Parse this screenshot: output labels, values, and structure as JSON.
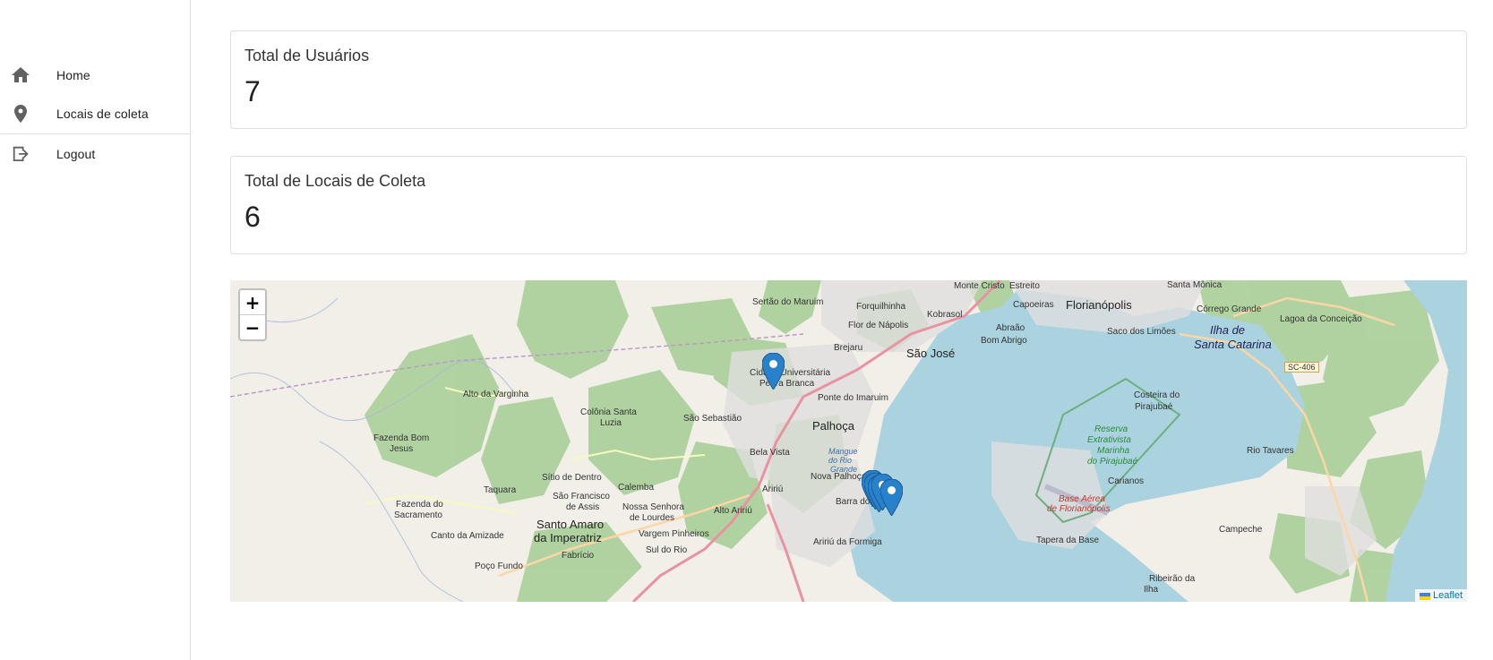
{
  "sidebar": {
    "items": [
      {
        "label": "Home",
        "icon": "home-icon"
      },
      {
        "label": "Locais de coleta",
        "icon": "location-pin-icon"
      },
      {
        "label": "Logout",
        "icon": "logout-icon"
      }
    ]
  },
  "stats": {
    "users": {
      "title": "Total de Usuários",
      "value": "7"
    },
    "locations": {
      "title": "Total de Locais de Coleta",
      "value": "6"
    }
  },
  "map": {
    "zoom_in": "+",
    "zoom_out": "−",
    "attribution": "Leaflet",
    "marker_count": 6,
    "labels": {
      "serto": "Sertão do Maruim",
      "forquilhinha": "Forquilhinha",
      "kobrasol": "Kobrasol",
      "montecristo": "Monte Cristo",
      "estreito": "Estreito",
      "capoeiras": "Capoeiras",
      "floripa": "Florianópolis",
      "santamonica": "Santa Mônica",
      "corrego": "Córrego Grande",
      "lagoa": "Lagoa da Conceição",
      "ilha": "Ilha de",
      "santacatarina": "Santa Catarina",
      "sacolimoes": "Saco dos Limões",
      "flornapolis": "Flor de Nápolis",
      "abraao": "Abraão",
      "bomabrigo": "Bom Abrigo",
      "saojose": "São José",
      "brejaru": "Brejaru",
      "cidadeuniv": "Cidade Universitária",
      "pedrabranca": "Pedra Branca",
      "pontedoimaruim": "Ponte do Imaruim",
      "altovarginha": "Alto da Varginha",
      "coloniasanta": "Colônia Santa",
      "luzia": "Luzia",
      "saosebastiao": "São Sebastião",
      "palhoca": "Palhoça",
      "belavista": "Bela Vista",
      "fazendabom": "Fazenda Bom",
      "jesus": "Jesus",
      "sitiodedentro": "Sítio de Dentro",
      "taquara": "Taquara",
      "calemba": "Calemba",
      "saofrancisco": "São Francisco",
      "deassis": "de Assis",
      "nossasenhora": "Nossa Senhora",
      "delourdes": "de Lourdes",
      "altoariri": "Alto Aririú",
      "ariri": "Aririú",
      "novapalhoca": "Nova Palhoça",
      "barradoariri": "Barra do Aririú",
      "fazendasacramento": "Fazenda do",
      "sacramento": "Sacramento",
      "cantoamizade": "Canto da Amizade",
      "santoamaro": "Santo Amaro",
      "daimperatriz": "da Imperatriz",
      "vargempinheiros": "Vargem Pinheiros",
      "suldorio": "Sul do Rio",
      "pocofundo": "Poço Fundo",
      "fabricio": "Fabrício",
      "aririformiga": "Aririú da Formiga",
      "costeira": "Costeira do",
      "pirajubae": "Pirajubaé",
      "reserva": "Reserva",
      "extrativista": "Extrativista",
      "marinha": "Marinha",
      "dopirajubae": "do Pirajubaé",
      "carianos": "Carianos",
      "baseaerea": "Base Aérea",
      "defloripa": "de Florianópolis",
      "tapera": "Tapera da Base",
      "riotavares": "Rio Tavares",
      "campeche": "Campeche",
      "ribeirao": "Ribeirão da",
      "ilha2": "Ilha",
      "sc406": "SC-406",
      "mangue": "Mangue",
      "dorio": "do Rio",
      "grande": "Grande"
    }
  }
}
